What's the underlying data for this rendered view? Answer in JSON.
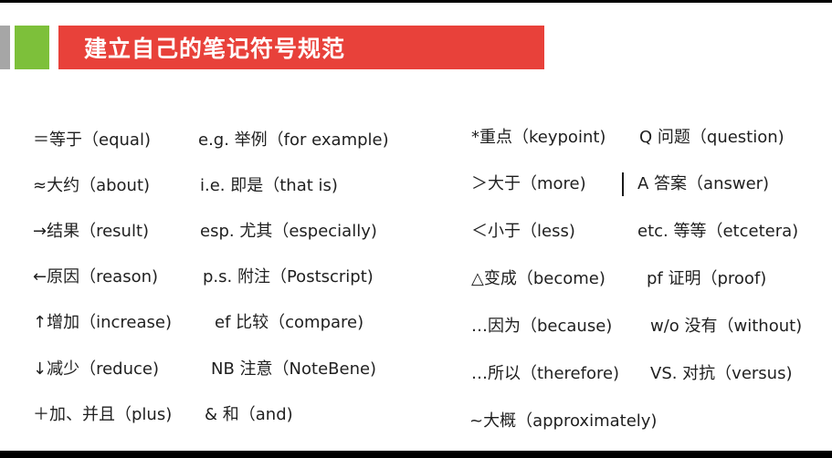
{
  "colors": {
    "title_bar": "#e8413a",
    "accent_green": "#7dc03a",
    "accent_gray": "#a6a6a6"
  },
  "header": {
    "title": "建立自己的笔记符号规范"
  },
  "columns": {
    "col1": [
      "＝等于（equal)",
      "≈大约（about)",
      "→结果（result)",
      "←原因（reason)",
      "↑增加（increase)",
      "↓减少（reduce)",
      "＋加、并且（plus)"
    ],
    "col2": [
      "e.g. 举例（for example)",
      "i.e. 即是（that is)",
      "esp. 尤其（especially)",
      "p.s. 附注（Postscript)",
      "ef 比较（compare)",
      "NB 注意（NoteBene)",
      "& 和（and)"
    ],
    "col3": [
      "*重点（keypoint)",
      "＞大于（more)",
      "＜小于（less)",
      "△变成（become)",
      "…因为（because)",
      "…所以（therefore)",
      "~大概（approximately)"
    ],
    "col4": [
      "Q 问题（question)",
      "A 答案（answer)",
      "etc. 等等（etcetera)",
      "pf 证明（proof)",
      "w/o 没有（without)",
      "VS. 对抗（versus)"
    ]
  }
}
